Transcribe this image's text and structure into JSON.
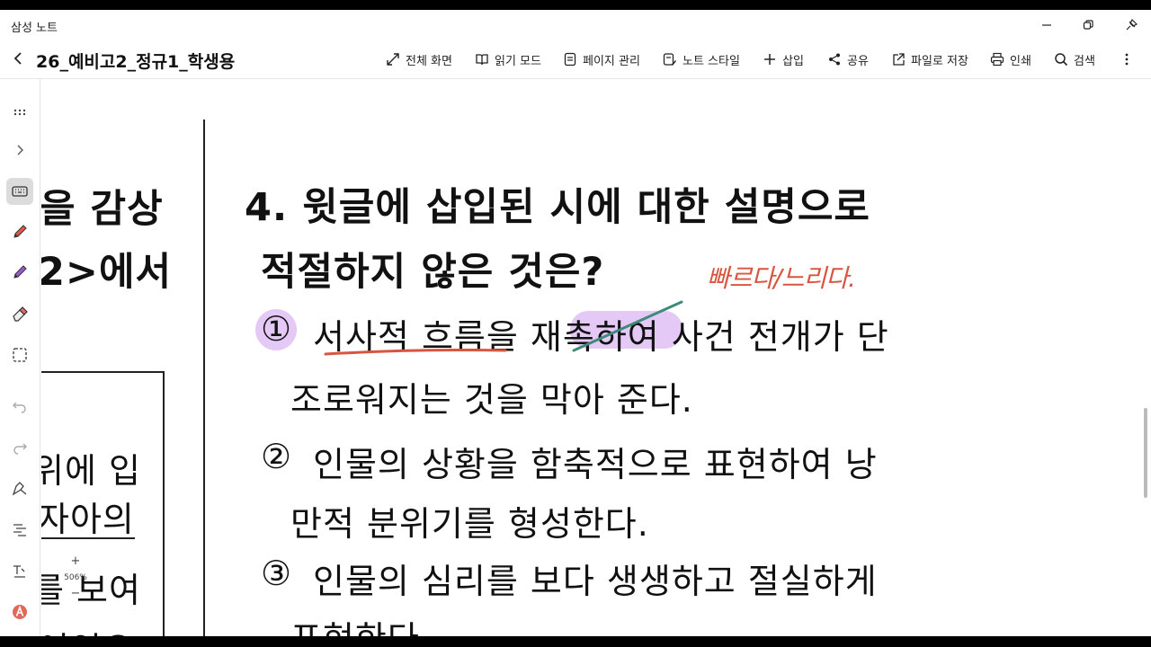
{
  "window": {
    "app_title": "삼성 노트"
  },
  "toolbar": {
    "doc_title": "26_예비고2_정규1_학생용",
    "items": [
      {
        "label": "전체 화면",
        "icon": "fullscreen-icon"
      },
      {
        "label": "읽기 모드",
        "icon": "book-icon"
      },
      {
        "label": "페이지 관리",
        "icon": "page-icon"
      },
      {
        "label": "노트 스타일",
        "icon": "style-icon"
      },
      {
        "label": "삽입",
        "icon": "plus-icon"
      },
      {
        "label": "공유",
        "icon": "share-icon"
      },
      {
        "label": "파일로 저장",
        "icon": "export-icon"
      },
      {
        "label": "인쇄",
        "icon": "print-icon"
      },
      {
        "label": "검색",
        "icon": "search-icon"
      }
    ]
  },
  "zoom": {
    "level": "506%",
    "plus": "+",
    "minus": "−"
  },
  "content": {
    "left_col": {
      "line1": "을 감상",
      "line2": "2>에서",
      "box_line1": "위에 입",
      "box_line2": "자아의",
      "box_line3": "를 보여",
      "box_line4": "여인으"
    },
    "question": {
      "line1": "4. 윗글에  삽입된  시에  대한  설명으로",
      "line2": "적절하지 않은 것은?"
    },
    "options": [
      {
        "num": "①",
        "line1": "서사적  흐름을  재촉하여  사건  전개가  단",
        "line2": "조로워지는  것을  막아  준다."
      },
      {
        "num": "②",
        "line1": "인물의  상황을  함축적으로  표현하여  낭",
        "line2": "만적  분위기를  형성한다."
      },
      {
        "num": "③",
        "line1": "인물의  심리를  보다  생생하고  절실하게",
        "line2": "표현한다."
      }
    ],
    "annotation": "빠르다/느리다."
  }
}
